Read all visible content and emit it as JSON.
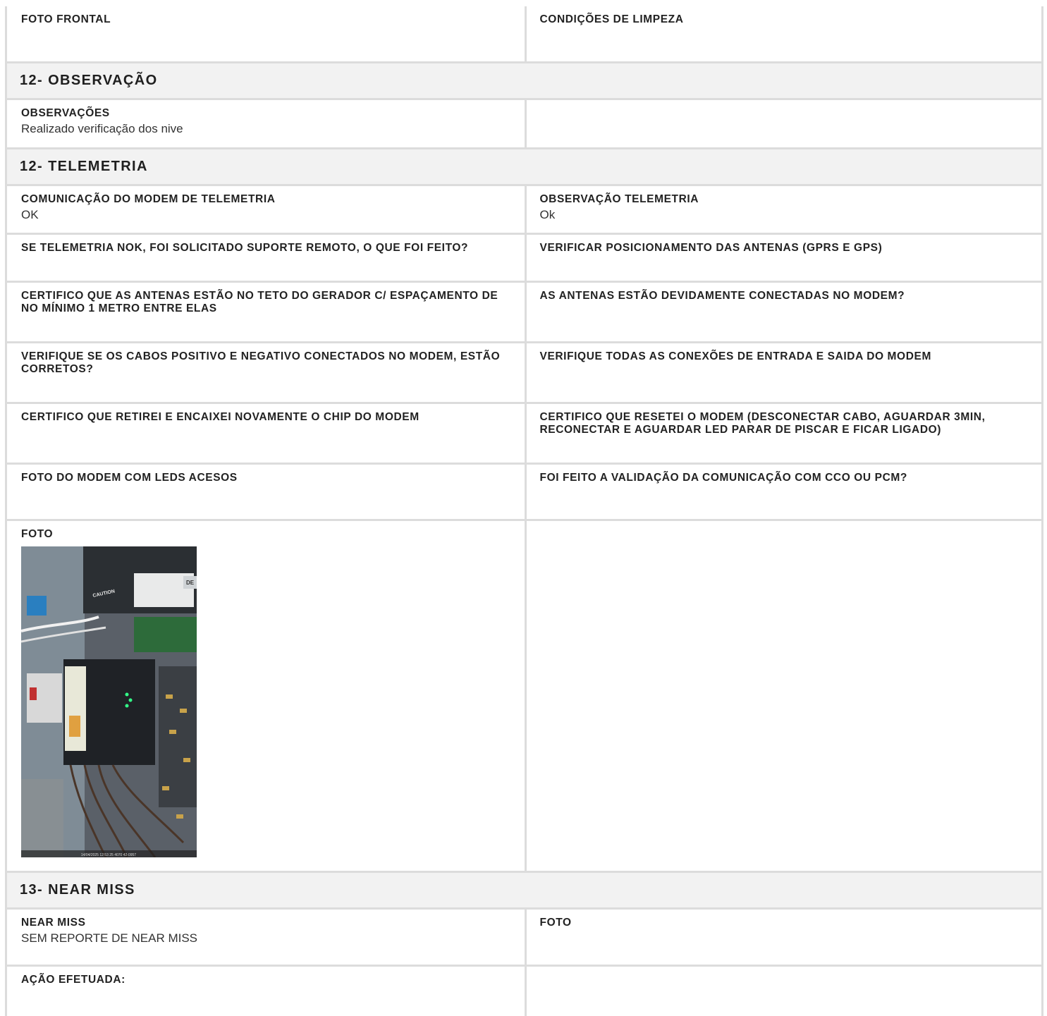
{
  "rows_top": {
    "foto_frontal": "FOTO FRONTAL",
    "condicoes_limpeza": "CONDIÇÕES DE LIMPEZA"
  },
  "sec_observacao": {
    "title": "12- OBSERVAÇÃO",
    "obs_label": "OBSERVAÇÕES",
    "obs_value": "Realizado verificação dos nive"
  },
  "sec_telemetria": {
    "title": "12- TELEMETRIA",
    "comunicacao_label": "COMUNICAÇÃO DO MODEM DE TELEMETRIA",
    "comunicacao_value": "OK",
    "obs_tel_label": "OBSERVAÇÃO TELEMETRIA",
    "obs_tel_value": "Ok",
    "nok_label": "SE TELEMETRIA NOK, FOI SOLICITADO SUPORTE REMOTO, O QUE FOI FEITO?",
    "posicionamento_label": "VERIFICAR POSICIONAMENTO DAS ANTENAS (GPRS E GPS)",
    "antenas_teto_label": "CERTIFICO QUE AS ANTENAS ESTÃO NO TETO DO GERADOR C/ ESPAÇAMENTO DE NO MÍNIMO 1 METRO ENTRE ELAS",
    "antenas_conectadas_label": "AS ANTENAS ESTÃO DEVIDAMENTE CONECTADAS NO MODEM?",
    "cabos_label": "VERIFIQUE SE OS CABOS POSITIVO E NEGATIVO CONECTADOS NO MODEM, ESTÃO CORRETOS?",
    "conexoes_label": "VERIFIQUE TODAS AS CONEXÕES DE ENTRADA E SAIDA DO MODEM",
    "chip_label": "CERTIFICO QUE RETIREI E ENCAIXEI NOVAMENTE O CHIP DO MODEM",
    "reset_label": "CERTIFICO QUE RESETEI O MODEM (DESCONECTAR CABO, AGUARDAR 3MIN, RECONECTAR E AGUARDAR LED PARAR DE PISCAR E FICAR LIGADO)",
    "foto_leds_label": "FOTO DO MODEM COM LEDS ACESOS",
    "validacao_label": "FOI FEITO A VALIDAÇÃO DA COMUNICAÇÃO COM CCO OU PCM?",
    "foto_label": "FOTO",
    "photo_caption": "14/04/2025 12:53 25 4070 42-0957"
  },
  "sec_near_miss": {
    "title": "13- NEAR MISS",
    "near_miss_label": "NEAR MISS",
    "near_miss_value": "SEM REPORTE DE NEAR MISS",
    "foto_label": "FOTO",
    "acao_label": "AÇÃO EFETUADA:"
  },
  "photo_text": {
    "caution": "CAUTION",
    "brand": "DE"
  }
}
